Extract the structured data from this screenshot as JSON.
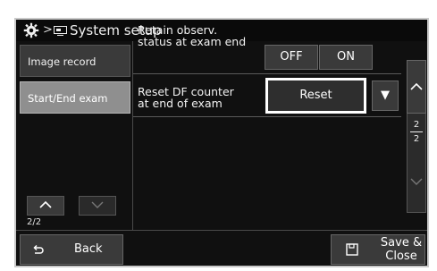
{
  "title": {
    "breadcrumb_separator": ">",
    "text": "System setup"
  },
  "sidebar": {
    "items": [
      {
        "label": "Image record",
        "active": false
      },
      {
        "label": "Start/End exam",
        "active": true
      }
    ],
    "page_indicator": "2/2"
  },
  "settings": {
    "retain": {
      "label_line1": "Retain observ.",
      "label_line2": "status at exam end",
      "options": [
        "OFF",
        "ON"
      ]
    },
    "reset_df": {
      "label_line1": "Reset DF counter",
      "label_line2": "at end of exam",
      "value": "Reset",
      "dropdown_glyph": "▼"
    }
  },
  "scroll": {
    "page_current": "2",
    "page_total": "2"
  },
  "bottom": {
    "back_label": "Back",
    "save_label_line1": "Save &",
    "save_label_line2": "Close"
  },
  "icons": {
    "gear": "gear-icon",
    "monitor": "monitor-icon",
    "back": "back-arrow-icon",
    "save": "save-icon",
    "up": "chevron-up-icon",
    "down": "chevron-down-icon"
  }
}
